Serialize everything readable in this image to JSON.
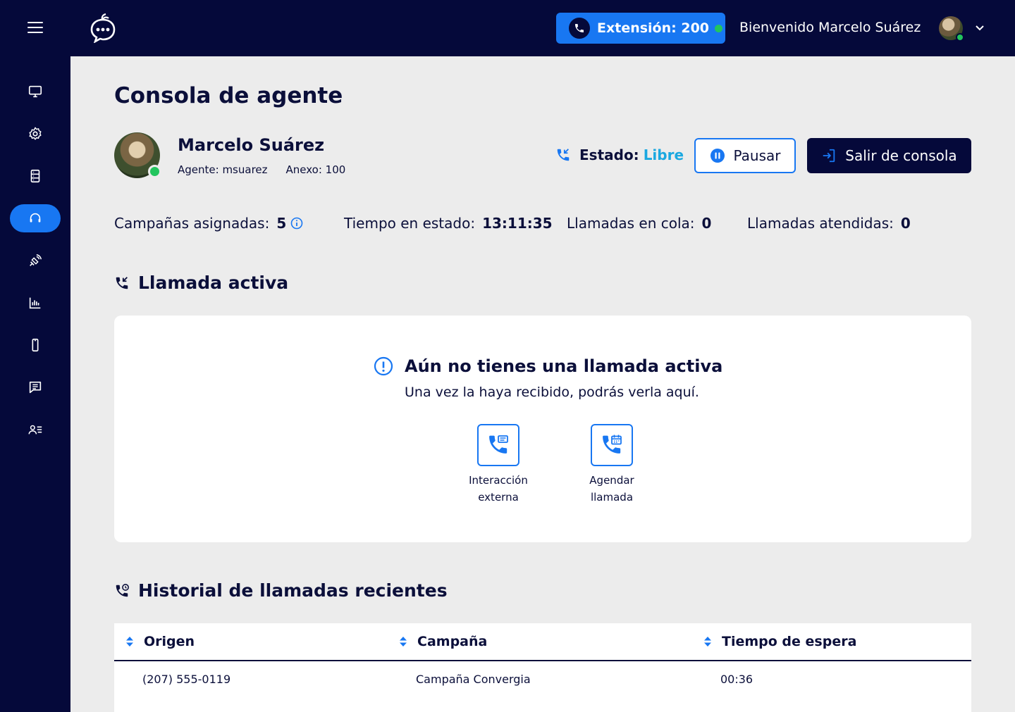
{
  "header": {
    "extension_label": "Extensión: 200",
    "welcome_text": "Bienvenido Marcelo Suárez"
  },
  "sidebar": {
    "items": [
      {
        "icon": "monitor-icon"
      },
      {
        "icon": "gear-icon"
      },
      {
        "icon": "database-icon"
      },
      {
        "icon": "headset-icon",
        "active": true
      },
      {
        "icon": "satellite-icon"
      },
      {
        "icon": "bar-chart-icon"
      },
      {
        "icon": "mobile-icon"
      },
      {
        "icon": "message-icon"
      },
      {
        "icon": "user-list-icon"
      }
    ]
  },
  "page": {
    "title": "Consola de agente"
  },
  "agent": {
    "name": "Marcelo Suárez",
    "agent_label": "Agente: msuarez",
    "anexo_label": "Anexo: 100",
    "estado_label": "Estado:",
    "estado_value": "Libre",
    "pause_button": "Pausar",
    "exit_button": "Salir de consola"
  },
  "stats": {
    "campaigns_label": "Campañas asignadas:",
    "campaigns_value": "5",
    "time_label": "Tiempo en estado:",
    "time_value": "13:11:35",
    "queue_label": "Llamadas en cola:",
    "queue_value": "0",
    "attended_label": "Llamadas atendidas:",
    "attended_value": "0"
  },
  "active_call": {
    "section_title": "Llamada activa",
    "empty_title": "Aún no tienes una llamada activa",
    "empty_subtitle": "Una vez la haya recibido, podrás verla aquí.",
    "action_external_line1": "Interacción",
    "action_external_line2": "externa",
    "action_schedule_line1": "Agendar",
    "action_schedule_line2": "llamada"
  },
  "history": {
    "section_title": "Historial de llamadas recientes",
    "columns": [
      "Origen",
      "Campaña",
      "Tiempo de espera"
    ],
    "rows": [
      [
        "(207) 555-0119",
        "Campaña Convergia",
        "00:36"
      ]
    ]
  },
  "colors": {
    "navy": "#05093a",
    "accent": "#1877f2",
    "status_free": "#1ba8e0",
    "online": "#22c55e"
  }
}
